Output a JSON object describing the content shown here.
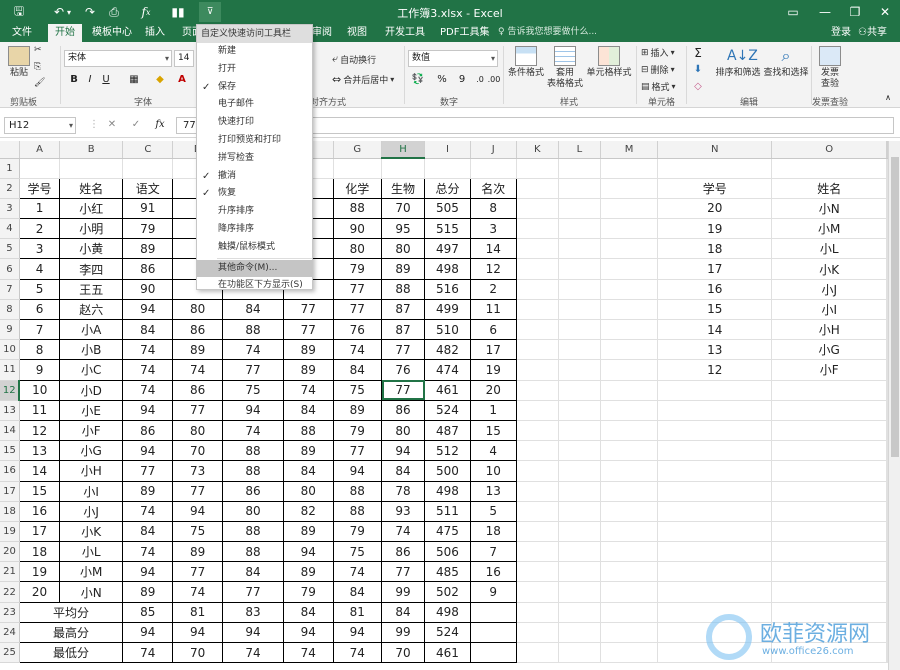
{
  "app": {
    "title": "工作簿3.xlsx - Excel"
  },
  "qat": {
    "save_icon": "save-icon",
    "undo_icon": "undo-icon",
    "redo_icon": "redo-icon",
    "preview_icon": "print-preview-icon",
    "fx_icon": "function-icon",
    "chart_icon": "chart-icon",
    "customize_icon": "qat-dropdown-icon"
  },
  "window_controls": {
    "ribbon_options": "▭",
    "minimize": "—",
    "restore": "❐",
    "close": "✕"
  },
  "tabs": [
    "文件",
    "开始",
    "模板中心",
    "插入",
    "页面",
    "审阅",
    "视图",
    "开发工具",
    "PDF工具集"
  ],
  "tell_me": "告诉我您想要做什么...",
  "account": {
    "login": "登录",
    "share": "共享"
  },
  "ribbon": {
    "clipboard": {
      "label": "剪贴板",
      "paste": "粘贴"
    },
    "font": {
      "label": "字体",
      "name": "宋体",
      "size": "14",
      "bold": "B",
      "italic": "I",
      "underline": "U"
    },
    "alignment": {
      "label": "对齐方式",
      "wrap": "自动换行",
      "merge": "合并后居中"
    },
    "number": {
      "label": "数字",
      "format": "数值",
      "percent": "%",
      "comma": "9"
    },
    "styles": {
      "label": "样式",
      "conditional": "条件格式",
      "table": "套用\n表格格式",
      "cell_styles": "单元格样式"
    },
    "cells": {
      "label": "单元格",
      "insert": "插入",
      "delete": "删除",
      "format": "格式"
    },
    "editing": {
      "label": "编辑",
      "sort": "排序和筛选",
      "find": "查找和选择"
    },
    "report": {
      "label": "发票查验",
      "check": "发票\n查验"
    }
  },
  "formula_bar": {
    "name_box": "H12",
    "cancel": "✕",
    "enter": "✓",
    "fx": "fx",
    "value": "77"
  },
  "menu": {
    "title": "自定义快速访问工具栏",
    "items": [
      {
        "label": "新建",
        "checked": false
      },
      {
        "label": "打开",
        "checked": false
      },
      {
        "label": "保存",
        "checked": true
      },
      {
        "label": "电子邮件",
        "checked": false
      },
      {
        "label": "快速打印",
        "checked": false
      },
      {
        "label": "打印预览和打印",
        "checked": false
      },
      {
        "label": "拼写检查",
        "checked": false
      },
      {
        "label": "撤消",
        "checked": true
      },
      {
        "label": "恢复",
        "checked": true
      },
      {
        "label": "升序排序",
        "checked": false
      },
      {
        "label": "降序排序",
        "checked": false
      },
      {
        "label": "触摸/鼠标模式",
        "checked": false
      },
      {
        "label": "其他命令(M)...",
        "checked": false,
        "highlighted": true
      },
      {
        "label": "在功能区下方显示(S)",
        "checked": false
      }
    ]
  },
  "sheet": {
    "columns": [
      "A",
      "B",
      "C",
      "D",
      "E",
      "F",
      "G",
      "H",
      "I",
      "J",
      "K",
      "L",
      "M",
      "N",
      "O"
    ],
    "selected_column": "H",
    "selected_row": 12,
    "row_numbers": [
      1,
      2,
      3,
      4,
      5,
      6,
      7,
      8,
      9,
      10,
      11,
      12,
      13,
      14,
      15,
      16,
      17,
      18,
      19,
      20,
      21,
      22,
      23,
      24,
      25
    ],
    "header": [
      "学号",
      "姓名",
      "语文",
      "",
      "",
      "",
      "化学",
      "生物",
      "总分",
      "名次"
    ],
    "students": [
      [
        "1",
        "小红",
        "91",
        "",
        "",
        "",
        "88",
        "70",
        "505",
        "8"
      ],
      [
        "2",
        "小明",
        "79",
        "",
        "",
        "",
        "90",
        "95",
        "515",
        "3"
      ],
      [
        "3",
        "小黄",
        "89",
        "",
        "",
        "",
        "80",
        "80",
        "497",
        "14"
      ],
      [
        "4",
        "李四",
        "86",
        "",
        "",
        "",
        "79",
        "89",
        "498",
        "12"
      ],
      [
        "5",
        "王五",
        "90",
        "",
        "",
        "",
        "77",
        "88",
        "516",
        "2"
      ],
      [
        "6",
        "赵六",
        "94",
        "80",
        "84",
        "77",
        "77",
        "87",
        "499",
        "11"
      ],
      [
        "7",
        "小A",
        "84",
        "86",
        "88",
        "77",
        "76",
        "87",
        "510",
        "6"
      ],
      [
        "8",
        "小B",
        "74",
        "89",
        "74",
        "89",
        "74",
        "77",
        "482",
        "17"
      ],
      [
        "9",
        "小C",
        "74",
        "74",
        "77",
        "89",
        "84",
        "76",
        "474",
        "19"
      ],
      [
        "10",
        "小D",
        "74",
        "86",
        "75",
        "74",
        "75",
        "77",
        "461",
        "20"
      ],
      [
        "11",
        "小E",
        "94",
        "77",
        "94",
        "84",
        "89",
        "86",
        "524",
        "1"
      ],
      [
        "12",
        "小F",
        "86",
        "80",
        "74",
        "88",
        "79",
        "80",
        "487",
        "15"
      ],
      [
        "13",
        "小G",
        "94",
        "70",
        "88",
        "89",
        "77",
        "94",
        "512",
        "4"
      ],
      [
        "14",
        "小H",
        "77",
        "73",
        "88",
        "84",
        "94",
        "84",
        "500",
        "10"
      ],
      [
        "15",
        "小I",
        "89",
        "77",
        "86",
        "80",
        "88",
        "78",
        "498",
        "13"
      ],
      [
        "16",
        "小J",
        "74",
        "94",
        "80",
        "82",
        "88",
        "93",
        "511",
        "5"
      ],
      [
        "17",
        "小K",
        "84",
        "75",
        "88",
        "89",
        "79",
        "74",
        "475",
        "18"
      ],
      [
        "18",
        "小L",
        "74",
        "89",
        "88",
        "94",
        "75",
        "86",
        "506",
        "7"
      ],
      [
        "19",
        "小M",
        "94",
        "77",
        "84",
        "89",
        "74",
        "77",
        "485",
        "16"
      ],
      [
        "20",
        "小N",
        "89",
        "74",
        "77",
        "79",
        "84",
        "99",
        "502",
        "9"
      ]
    ],
    "summary": [
      {
        "label": "平均分",
        "values": [
          "85",
          "81",
          "83",
          "84",
          "81",
          "84",
          "498"
        ]
      },
      {
        "label": "最高分",
        "values": [
          "94",
          "94",
          "94",
          "94",
          "94",
          "99",
          "524"
        ]
      },
      {
        "label": "最低分",
        "values": [
          "74",
          "70",
          "74",
          "74",
          "74",
          "70",
          "461"
        ]
      }
    ],
    "side_header": [
      "学号",
      "姓名"
    ],
    "side_rows": [
      [
        "20",
        "小N"
      ],
      [
        "19",
        "小M"
      ],
      [
        "18",
        "小L"
      ],
      [
        "17",
        "小K"
      ],
      [
        "16",
        "小J"
      ],
      [
        "15",
        "小I"
      ],
      [
        "14",
        "小H"
      ],
      [
        "13",
        "小G"
      ],
      [
        "12",
        "小F"
      ]
    ]
  },
  "watermark": {
    "text": "欧菲资源网",
    "url": "www.office26.com"
  },
  "colors": {
    "brand": "#217346",
    "ribbon_bg": "#f3f3f3",
    "menu_highlight": "#c5c5c5"
  }
}
